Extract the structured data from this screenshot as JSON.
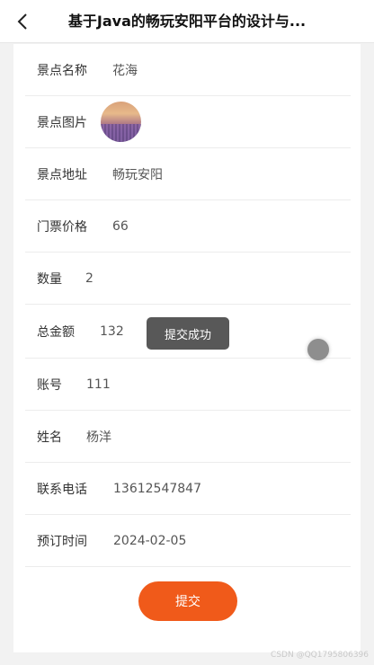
{
  "header": {
    "title": "基于Java的畅玩安阳平台的设计与..."
  },
  "form": {
    "scenic_name": {
      "label": "景点名称",
      "value": "花海"
    },
    "scenic_image": {
      "label": "景点图片"
    },
    "scenic_address": {
      "label": "景点地址",
      "value": "畅玩安阳"
    },
    "ticket_price": {
      "label": "门票价格",
      "value": "66"
    },
    "quantity": {
      "label": "数量",
      "value": "2"
    },
    "total_amount": {
      "label": "总金额",
      "value": "132"
    },
    "account": {
      "label": "账号",
      "value": "111"
    },
    "name": {
      "label": "姓名",
      "value": "杨洋"
    },
    "phone": {
      "label": "联系电话",
      "value": "13612547847"
    },
    "booking_time": {
      "label": "预订时间",
      "value": "2024-02-05"
    }
  },
  "toast": {
    "text": "提交成功"
  },
  "submit": {
    "label": "提交"
  },
  "watermark": "CSDN @QQ1795806396",
  "colors": {
    "accent": "#f05a1a",
    "toast_bg": "#464646",
    "page_bg": "#f2f2f2"
  },
  "icons": {
    "back": "chevron-left-icon"
  }
}
